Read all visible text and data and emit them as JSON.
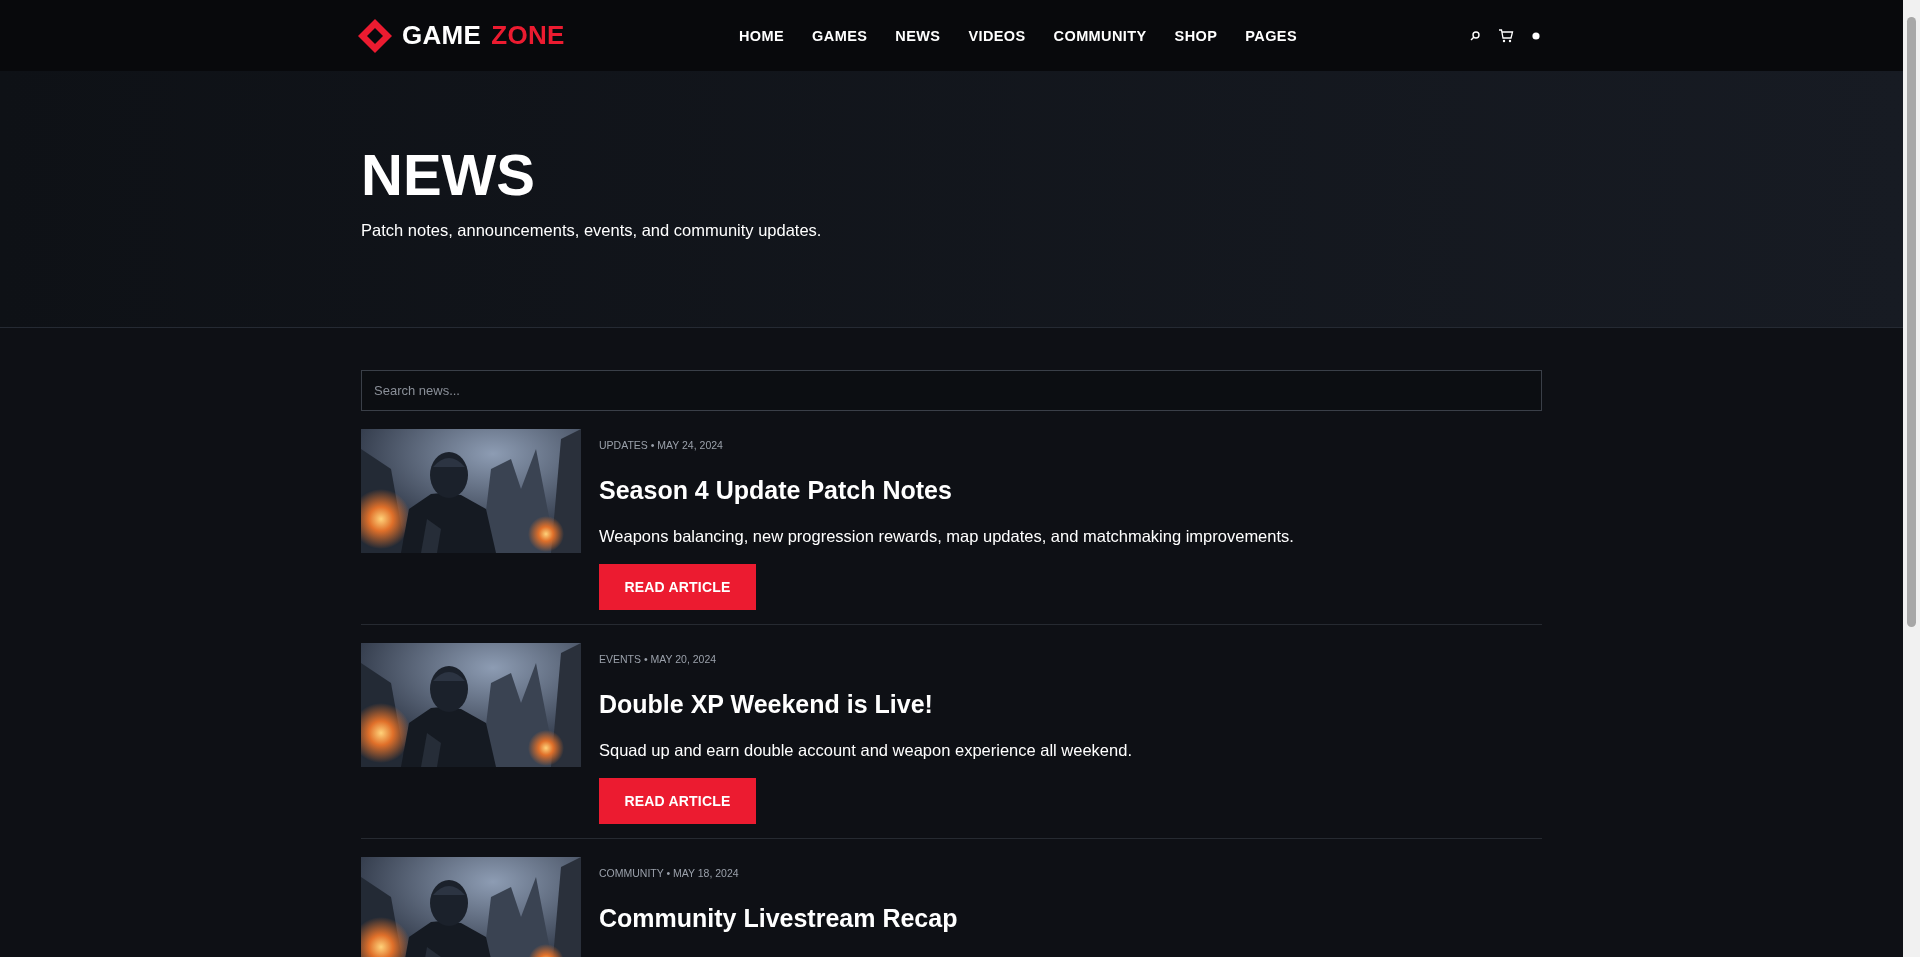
{
  "header": {
    "logo": {
      "part_1": "GAME",
      "part_2": "ZONE"
    },
    "nav": [
      {
        "label": "HOME",
        "selected": false
      },
      {
        "label": "GAMES",
        "selected": false
      },
      {
        "label": "NEWS",
        "selected": false
      },
      {
        "label": "VIDEOS",
        "selected": false
      },
      {
        "label": "COMMUNITY",
        "selected": false
      },
      {
        "label": "SHOP",
        "selected": false
      },
      {
        "label": "PAGES",
        "selected": false
      }
    ]
  },
  "hero": {
    "title": "NEWS",
    "subtitle": "Patch notes, announcements, events, and community updates."
  },
  "search": {
    "placeholder": "Search news..."
  },
  "articles": [
    {
      "meta": "UPDATES • MAY 24, 2024",
      "title": "Season 4 Update Patch Notes",
      "summary": "Weapons balancing, new progression rewards, map updates, and matchmaking improvements.",
      "button": "READ ARTICLE"
    },
    {
      "meta": "EVENTS • MAY 20, 2024",
      "title": "Double XP Weekend is Live!",
      "summary": "Squad up and earn double account and weapon experience all weekend.",
      "button": "READ ARTICLE"
    },
    {
      "meta": "COMMUNITY • MAY 18, 2024",
      "title": "Community Livestream Recap"
    }
  ]
}
